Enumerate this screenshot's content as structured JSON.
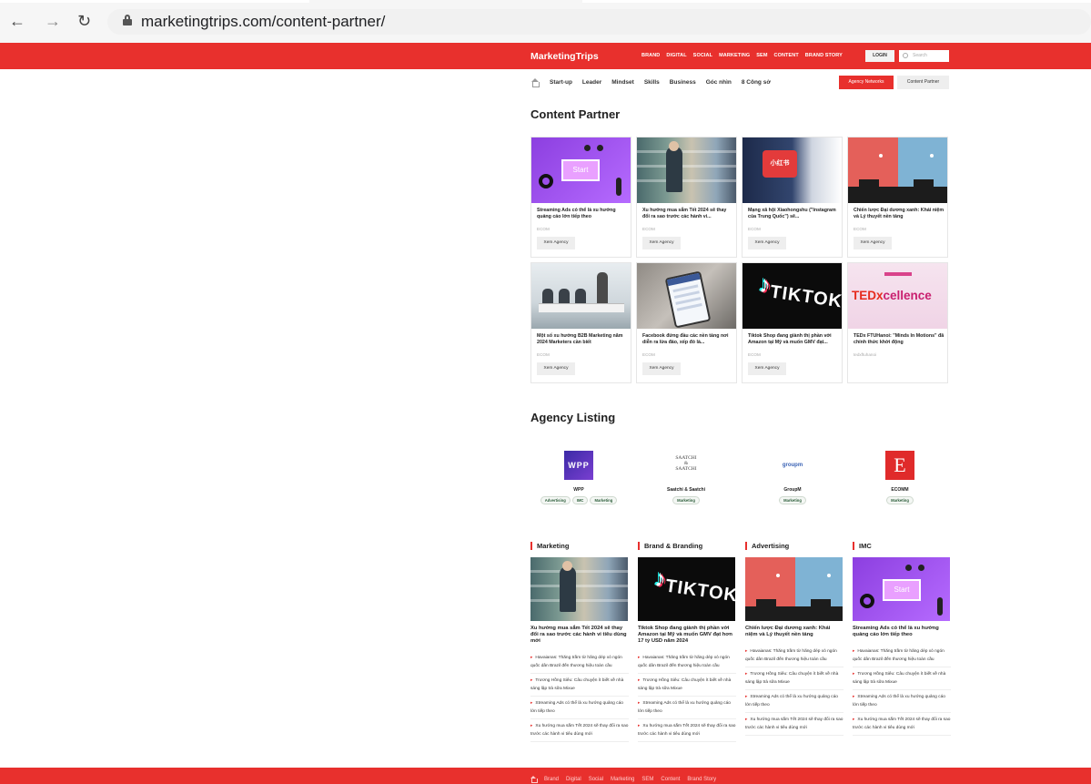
{
  "browser": {
    "url": "marketingtrips.com/content-partner/"
  },
  "header": {
    "brand": "MarketingTrips",
    "nav": [
      "BRAND",
      "DIGITAL",
      "SOCIAL",
      "MARKETING",
      "SEM",
      "CONTENT",
      "BRAND STORY"
    ],
    "login_label": "LOGIN",
    "search_placeholder": "Search"
  },
  "subnav": {
    "items": [
      "Start-up",
      "Leader",
      "Mindset",
      "Skills",
      "Business",
      "Góc nhìn",
      "8 Công sở"
    ],
    "agency_networks_label": "Agency Networks",
    "content_partner_label": "Content Partner"
  },
  "content_partner": {
    "title": "Content Partner",
    "cards": [
      {
        "title": "Streaming Ads có thể là xu hướng quảng cáo lớn tiếp theo",
        "category": "ECOM",
        "button": "Xem Agency"
      },
      {
        "title": "Xu hướng mua sắm Tết 2024 sẽ thay đổi ra sao trước các hành vi...",
        "category": "ECOM",
        "button": "Xem Agency"
      },
      {
        "title": "Mạng xã hội Xiaohongshu (\"Instagram của Trung Quốc\") sẽ...",
        "category": "ECOM",
        "button": "Xem Agency"
      },
      {
        "title": "Chiến lược Đại dương xanh: Khái niệm và Lý thuyết nền tảng",
        "category": "ECOM",
        "button": "Xem Agency"
      },
      {
        "title": "Một số xu hướng B2B Marketing năm 2024 Marketers cần biết",
        "category": "ECOM",
        "button": "Xem Agency"
      },
      {
        "title": "Facebook đứng đầu các nền tảng nơi diễn ra lừa đảo, xếp đó là...",
        "category": "ECOM",
        "button": "Xem Agency"
      },
      {
        "title": "Tiktok Shop đang giành thị phần với Amazon tại Mỹ và muốn GMV đạt...",
        "category": "ECOM",
        "button": "Xem Agency"
      },
      {
        "title": "TEDx FTUHanoi: \"Minds In Motions\" đã chính thức khởi động",
        "category": "tedxftuhanoi",
        "button": ""
      }
    ]
  },
  "agency_listing": {
    "title": "Agency Listing",
    "agencies": [
      {
        "name": "WPP",
        "logo": "WPP",
        "tags": [
          "Advertising",
          "IMC",
          "Marketing"
        ]
      },
      {
        "name": "Saatchi & Saatchi",
        "logo_lines": [
          "SAATCHI",
          "&",
          "SAATCHI"
        ],
        "tags": [
          "Marketing"
        ]
      },
      {
        "name": "GroupM",
        "logo": "groupm",
        "tags": [
          "Marketing"
        ]
      },
      {
        "name": "ECOMM",
        "logo": "E",
        "tags": [
          "Marketing"
        ]
      }
    ]
  },
  "categories": [
    {
      "heading": "Marketing",
      "feature": "Xu hướng mua sắm Tết 2024 sẽ thay đổi ra sao trước các hành vi tiêu dùng mới",
      "links": [
        "Havaianas: Thăng trầm từ hãng dép xỏ ngón quốc dân Brazil đến thương hiệu toàn cầu",
        "Trương Hồng Siêu: Câu chuyện ít biết về nhà sáng lập trà sữa Mixue",
        "Streaming Ads có thể là xu hướng quảng cáo lớn tiếp theo",
        "Xu hướng mua sắm Tết 2024 sẽ thay đổi ra sao trước các hành vi tiêu dùng mới"
      ]
    },
    {
      "heading": "Brand & Branding",
      "feature": "Tiktok Shop đang giành thị phần với Amazon tại Mỹ và muốn GMV đạt hơn 17 tỷ USD năm 2024",
      "links": [
        "Havaianas: Thăng trầm từ hãng dép xỏ ngón quốc dân Brazil đến thương hiệu toàn cầu",
        "Trương Hồng Siêu: Câu chuyện ít biết về nhà sáng lập trà sữa Mixue",
        "Streaming Ads có thể là xu hướng quảng cáo lớn tiếp theo",
        "Xu hướng mua sắm Tết 2024 sẽ thay đổi ra sao trước các hành vi tiêu dùng mới"
      ]
    },
    {
      "heading": "Advertising",
      "feature": "Chiến lược Đại dương xanh: Khái niệm và Lý thuyết nền tảng",
      "links": [
        "Havaianas: Thăng trầm từ hãng dép xỏ ngón quốc dân Brazil đến thương hiệu toàn cầu",
        "Trương Hồng Siêu: Câu chuyện ít biết về nhà sáng lập trà sữa Mixue",
        "Streaming Ads có thể là xu hướng quảng cáo lớn tiếp theo",
        "Xu hướng mua sắm Tết 2024 sẽ thay đổi ra sao trước các hành vi tiêu dùng mới"
      ]
    },
    {
      "heading": "IMC",
      "feature": "Streaming Ads có thể là xu hướng quảng cáo lớn tiếp theo",
      "links": [
        "Havaianas: Thăng trầm từ hãng dép xỏ ngón quốc dân Brazil đến thương hiệu toàn cầu",
        "Trương Hồng Siêu: Câu chuyện ít biết về nhà sáng lập trà sữa Mixue",
        "Streaming Ads có thể là xu hướng quảng cáo lớn tiếp theo",
        "Xu hướng mua sắm Tết 2024 sẽ thay đổi ra sao trước các hành vi tiêu dùng mới"
      ]
    }
  ],
  "footer": {
    "nav": [
      "Brand",
      "Digital",
      "Social",
      "Marketing",
      "SEM",
      "Content",
      "Brand Story"
    ]
  },
  "colors": {
    "brand_red": "#e8302d"
  }
}
